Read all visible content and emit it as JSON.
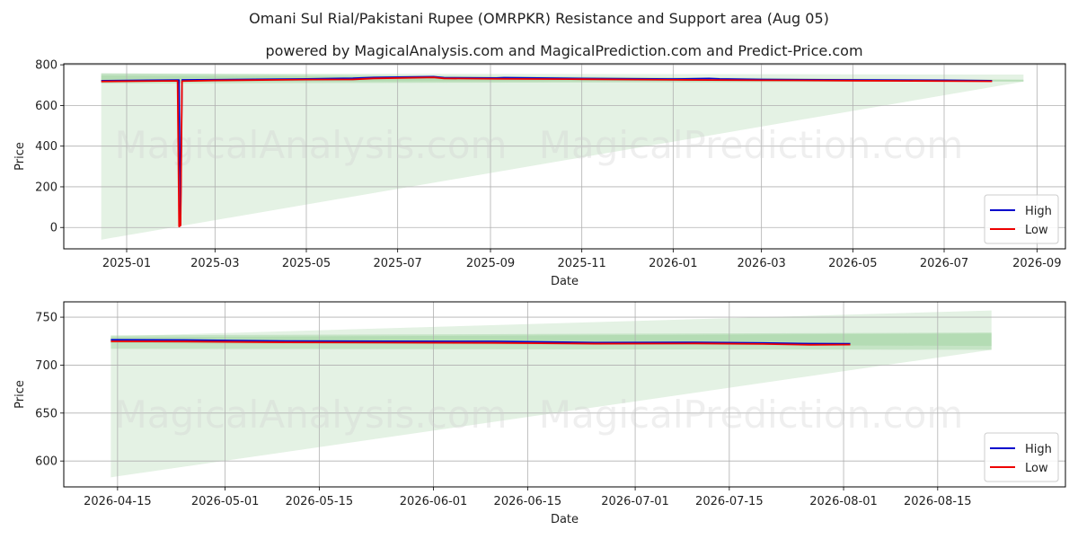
{
  "title": "Omani Sul Rial/Pakistani Rupee (OMRPKR) Resistance and Support area (Aug 05)",
  "subtitle": "powered by MagicalAnalysis.com and MagicalPrediction.com and Predict-Price.com",
  "watermarks": [
    "MagicalAnalysis.com",
    "MagicalPrediction.com"
  ],
  "colors": {
    "high": "#0000cc",
    "low": "#ee0000",
    "band": "#9fd39f",
    "cone": "#e4f2e4",
    "grid": "#b0b0b0"
  },
  "chart_data": [
    {
      "type": "line",
      "xlabel": "Date",
      "ylabel": "Price",
      "ylim": [
        -105,
        805
      ],
      "xlim": [
        "2024-11-20",
        "2026-09-20"
      ],
      "yticks": [
        0,
        200,
        400,
        600,
        800
      ],
      "xticks": [
        "2025-01",
        "2025-03",
        "2025-05",
        "2025-07",
        "2025-09",
        "2025-11",
        "2026-01",
        "2026-03",
        "2026-05",
        "2026-07",
        "2026-09"
      ],
      "grid": true,
      "legend": "bottom-right",
      "series": [
        {
          "name": "High",
          "x": [
            "2024-12-15",
            "2025-01-15",
            "2025-02-05",
            "2025-02-06",
            "2025-02-07",
            "2025-03-01",
            "2025-05-01",
            "2025-06-01",
            "2025-06-15",
            "2025-07-25",
            "2025-08-01",
            "2025-09-05",
            "2025-09-10",
            "2025-11-01",
            "2026-01-01",
            "2026-01-25",
            "2026-02-01",
            "2026-03-01",
            "2026-05-01",
            "2026-07-01",
            "2026-08-02"
          ],
          "y": [
            722,
            724,
            725,
            15,
            726,
            727,
            731,
            734,
            738,
            742,
            737,
            735,
            737,
            733,
            730,
            733,
            731,
            728,
            726,
            724,
            722
          ]
        },
        {
          "name": "Low",
          "x": [
            "2024-12-15",
            "2025-01-15",
            "2025-02-04",
            "2025-02-05",
            "2025-02-06",
            "2025-02-07",
            "2025-03-01",
            "2025-05-01",
            "2025-06-01",
            "2025-06-15",
            "2025-07-25",
            "2025-08-01",
            "2025-09-05",
            "2025-11-01",
            "2026-01-01",
            "2026-03-01",
            "2026-05-01",
            "2026-07-01",
            "2026-08-02"
          ],
          "y": [
            718,
            720,
            721,
            5,
            10,
            720,
            723,
            727,
            728,
            733,
            738,
            733,
            731,
            729,
            726,
            724,
            722,
            720,
            719
          ]
        }
      ],
      "bands": [
        {
          "x": [
            "2024-12-15",
            "2026-08-23"
          ],
          "lower": [
            708,
            717
          ],
          "upper": [
            758,
            727
          ]
        },
        {
          "x": [
            "2024-12-15",
            "2026-08-23"
          ],
          "lower": [
            718,
            720
          ],
          "upper": [
            748,
            724
          ]
        }
      ],
      "cone": {
        "x": [
          "2024-12-15",
          "2026-08-23"
        ],
        "lower": [
          -60,
          717
        ],
        "upper": [
          758,
          752
        ]
      }
    },
    {
      "type": "line",
      "xlabel": "Date",
      "ylabel": "Price",
      "ylim": [
        573,
        766
      ],
      "xlim": [
        "2026-04-07",
        "2026-09-03"
      ],
      "yticks": [
        600,
        650,
        700,
        750
      ],
      "xticks": [
        "2026-04-15",
        "2026-05-01",
        "2026-05-15",
        "2026-06-01",
        "2026-06-15",
        "2026-07-01",
        "2026-07-15",
        "2026-08-01",
        "2026-08-15"
      ],
      "grid": true,
      "legend": "bottom-right",
      "series": [
        {
          "name": "High",
          "x": [
            "2026-04-14",
            "2026-04-25",
            "2026-05-10",
            "2026-05-25",
            "2026-06-10",
            "2026-06-25",
            "2026-07-10",
            "2026-07-20",
            "2026-07-27",
            "2026-08-02"
          ],
          "y": [
            726.5,
            726.2,
            725.2,
            725,
            724.8,
            723.6,
            723.8,
            723.2,
            722.5,
            722.4
          ]
        },
        {
          "name": "Low",
          "x": [
            "2026-04-14",
            "2026-04-25",
            "2026-05-10",
            "2026-05-25",
            "2026-06-10",
            "2026-06-25",
            "2026-07-10",
            "2026-07-20",
            "2026-07-27",
            "2026-08-02"
          ],
          "y": [
            724.8,
            724.6,
            723.8,
            723.5,
            723.2,
            722.4,
            722.6,
            722.1,
            721.2,
            721.4
          ]
        }
      ],
      "bands": [
        {
          "x": [
            "2026-04-14",
            "2026-08-23"
          ],
          "lower": [
            717,
            716
          ],
          "upper": [
            731,
            734
          ]
        },
        {
          "x": [
            "2026-04-14",
            "2026-08-23"
          ],
          "lower": [
            723,
            720
          ],
          "upper": [
            729,
            733
          ]
        }
      ],
      "cone": {
        "x": [
          "2026-04-14",
          "2026-08-23"
        ],
        "lower": [
          583,
          716
        ],
        "upper": [
          730,
          757
        ]
      }
    }
  ]
}
